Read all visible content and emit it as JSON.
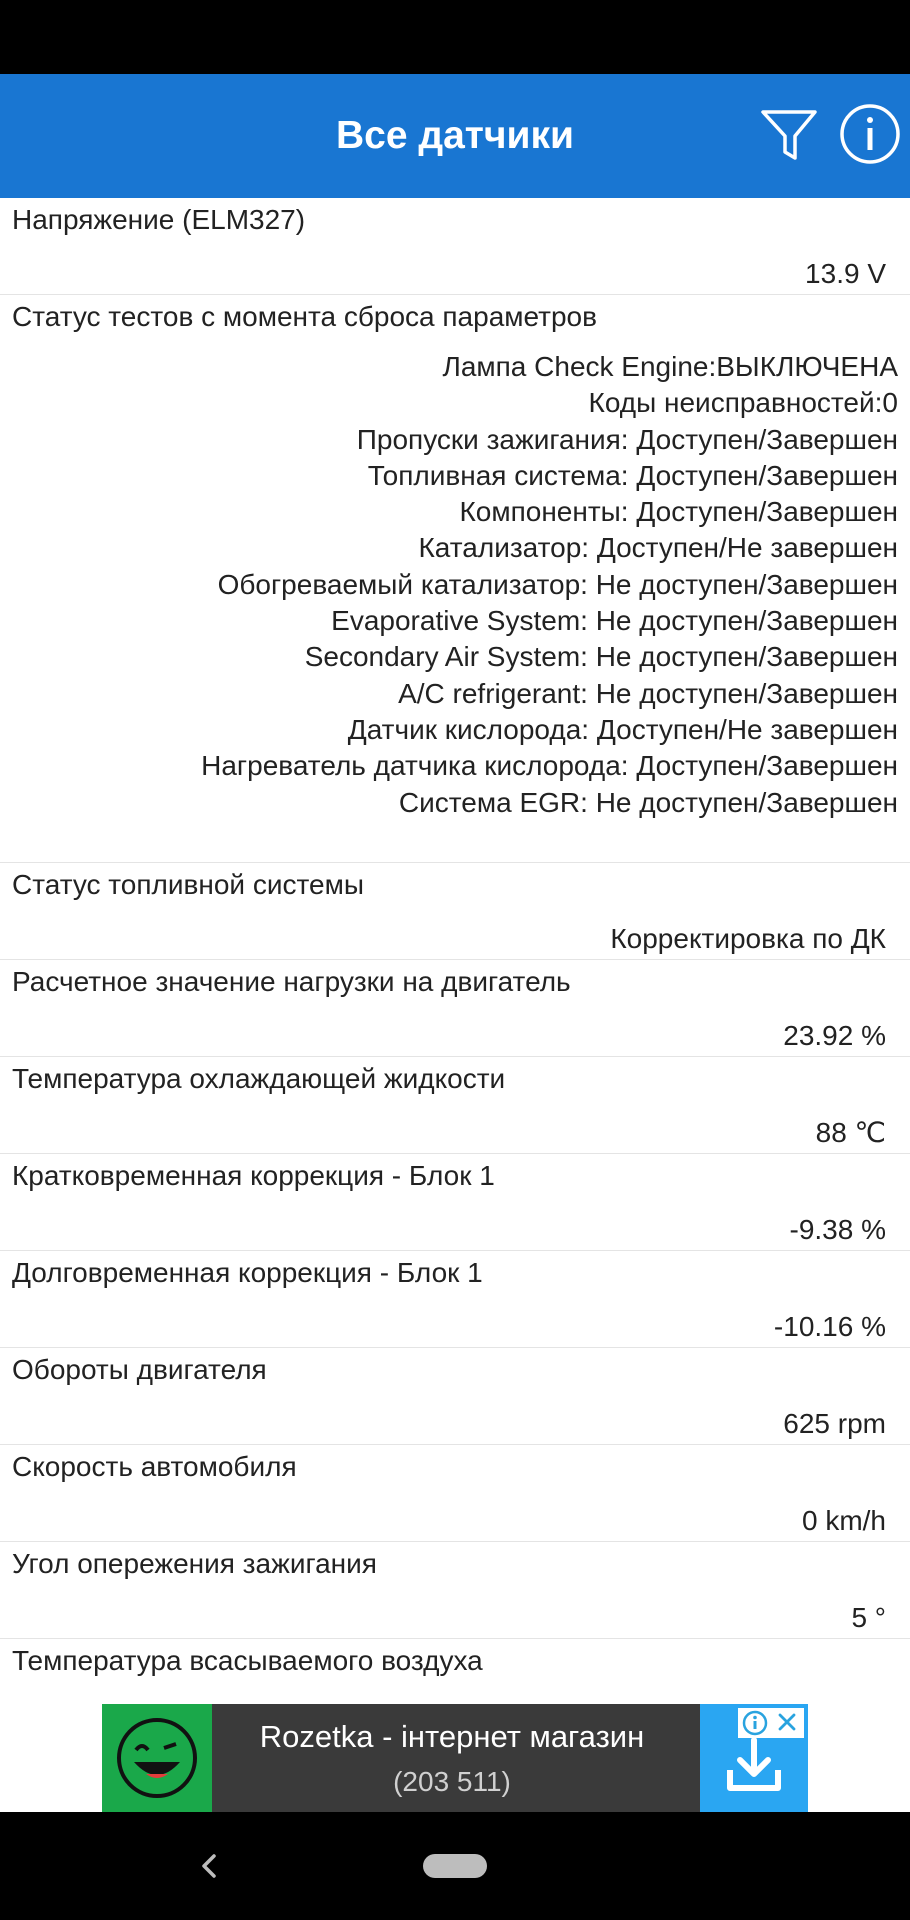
{
  "app_bar": {
    "title": "Все датчики",
    "color": "#1976d2",
    "actions": [
      "filter-icon",
      "info-icon"
    ]
  },
  "sensors": [
    {
      "label": "Напряжение (ELM327)",
      "value": "13.9 V"
    },
    {
      "label": "Статус тестов с момента сброса параметров",
      "lines": [
        "Лампа Check Engine:ВЫКЛЮЧЕНА",
        "Коды неисправностей:0",
        "Пропуски зажигания: Доступен/Завершен",
        "Топливная система: Доступен/Завершен",
        "Компоненты: Доступен/Завершен",
        "Катализатор: Доступен/Не завершен",
        "Обогреваемый катализатор: Не доступен/Завершен",
        "Evaporative System: Не доступен/Завершен",
        "Secondary Air System: Не доступен/Завершен",
        "A/C refrigerant: Не доступен/Завершен",
        "Датчик кислорода: Доступен/Не завершен",
        "Нагреватель датчика кислорода: Доступен/Завершен",
        "Система EGR: Не доступен/Завершен"
      ]
    },
    {
      "label": "Статус топливной системы",
      "value": "Корректировка по ДК"
    },
    {
      "label": "Расчетное значение нагрузки на двигатель",
      "value": "23.92 %"
    },
    {
      "label": "Температура охлаждающей жидкости",
      "value": "88 ℃"
    },
    {
      "label": "Кратковременная коррекция - Блок 1",
      "value": "-9.38 %"
    },
    {
      "label": "Долговременная коррекция - Блок 1",
      "value": "-10.16 %"
    },
    {
      "label": "Обороты двигателя",
      "value": "625 rpm"
    },
    {
      "label": "Скорость автомобиля",
      "value": "0 km/h"
    },
    {
      "label": "Угол опережения зажигания",
      "value": "5 °"
    },
    {
      "label": "Температура всасываемого воздуха",
      "value": ""
    }
  ],
  "ad": {
    "title": "Rozetka - інтернет магазин",
    "count": "(203 511)",
    "icons": [
      "rozetka-logo-icon",
      "download-icon",
      "adchoices-icon",
      "close-icon"
    ]
  },
  "nav": {
    "icons": [
      "back-icon",
      "home-pill-icon"
    ]
  }
}
